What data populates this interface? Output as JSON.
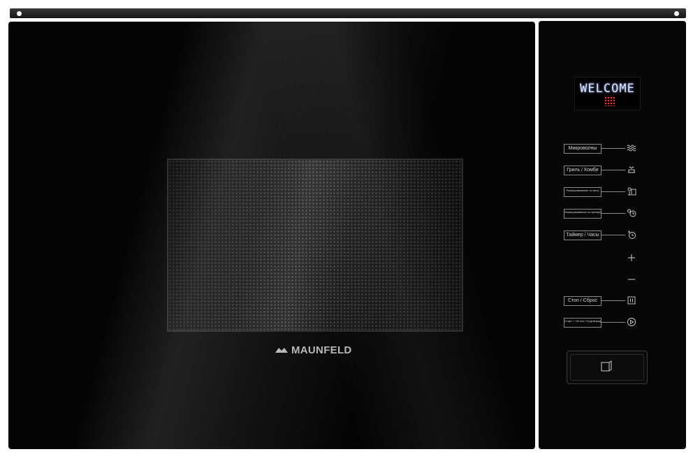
{
  "brand": {
    "name": "MAUNFELD"
  },
  "display": {
    "text": "WELCOME"
  },
  "controls": [
    {
      "label": "Микроволны",
      "icon": "waves-icon"
    },
    {
      "label": "Гриль / Комби",
      "icon": "grill-icon"
    },
    {
      "label": "Размораживание по весу",
      "icon": "defrost-weight-icon"
    },
    {
      "label": "Размораживание по времени",
      "icon": "defrost-time-icon"
    },
    {
      "label": "Таймер / Часы",
      "icon": "timer-clock-icon"
    },
    {
      "label": "Стоп / Сброс",
      "icon": "stop-icon"
    },
    {
      "label": "Старт / +30 сек / Подтверждение",
      "icon": "start-icon"
    }
  ],
  "colors": {
    "body": "#050505",
    "display_text": "#d9e4ff",
    "display_dots": "#ff2a2a",
    "print": "#d5d5d5"
  }
}
